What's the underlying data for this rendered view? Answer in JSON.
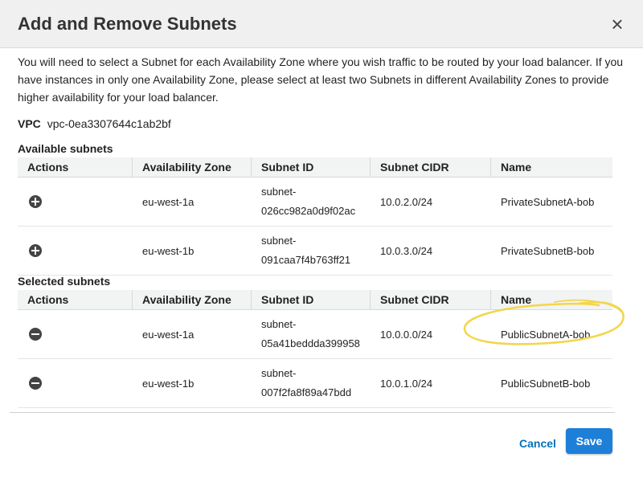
{
  "dialog": {
    "title": "Add and Remove Subnets",
    "close_glyph": "×",
    "description": "You will need to select a Subnet for each Availability Zone where you wish traffic to be routed by your load balancer. If you have instances in only one Availability Zone, please select at least two Subnets in different Availability Zones to provide higher availability for your load balancer.",
    "vpc_label": "VPC",
    "vpc_value": "vpc-0ea3307644c1ab2bf"
  },
  "columns": [
    "Actions",
    "Availability Zone",
    "Subnet ID",
    "Subnet CIDR",
    "Name"
  ],
  "available": {
    "label": "Available subnets",
    "rows": [
      {
        "action": "add-icon",
        "zone": "eu-west-1a",
        "id_line1": "subnet-",
        "id_line2": "026cc982a0d9f02ac",
        "cidr": "10.0.2.0/24",
        "name": "PrivateSubnetA-bob"
      },
      {
        "action": "add-icon",
        "zone": "eu-west-1b",
        "id_line1": "subnet-",
        "id_line2": "091caa7f4b763ff21",
        "cidr": "10.0.3.0/24",
        "name": "PrivateSubnetB-bob"
      }
    ]
  },
  "selected": {
    "label": "Selected subnets",
    "rows": [
      {
        "action": "remove-icon",
        "zone": "eu-west-1a",
        "id_line1": "subnet-",
        "id_line2": "05a41beddda399958",
        "cidr": "10.0.0.0/24",
        "name": "PublicSubnetA-bob"
      },
      {
        "action": "remove-icon",
        "zone": "eu-west-1b",
        "id_line1": "subnet-",
        "id_line2": "007f2fa8f89a47bdd",
        "cidr": "10.0.1.0/24",
        "name": "PublicSubnetB-bob"
      }
    ]
  },
  "footer": {
    "cancel_label": "Cancel",
    "save_label": "Save"
  },
  "colors": {
    "header_bg": "#f0f0f0",
    "link": "#0073bb",
    "primary_button": "#1e7fd9",
    "highlight_marker": "#f2d64b"
  }
}
